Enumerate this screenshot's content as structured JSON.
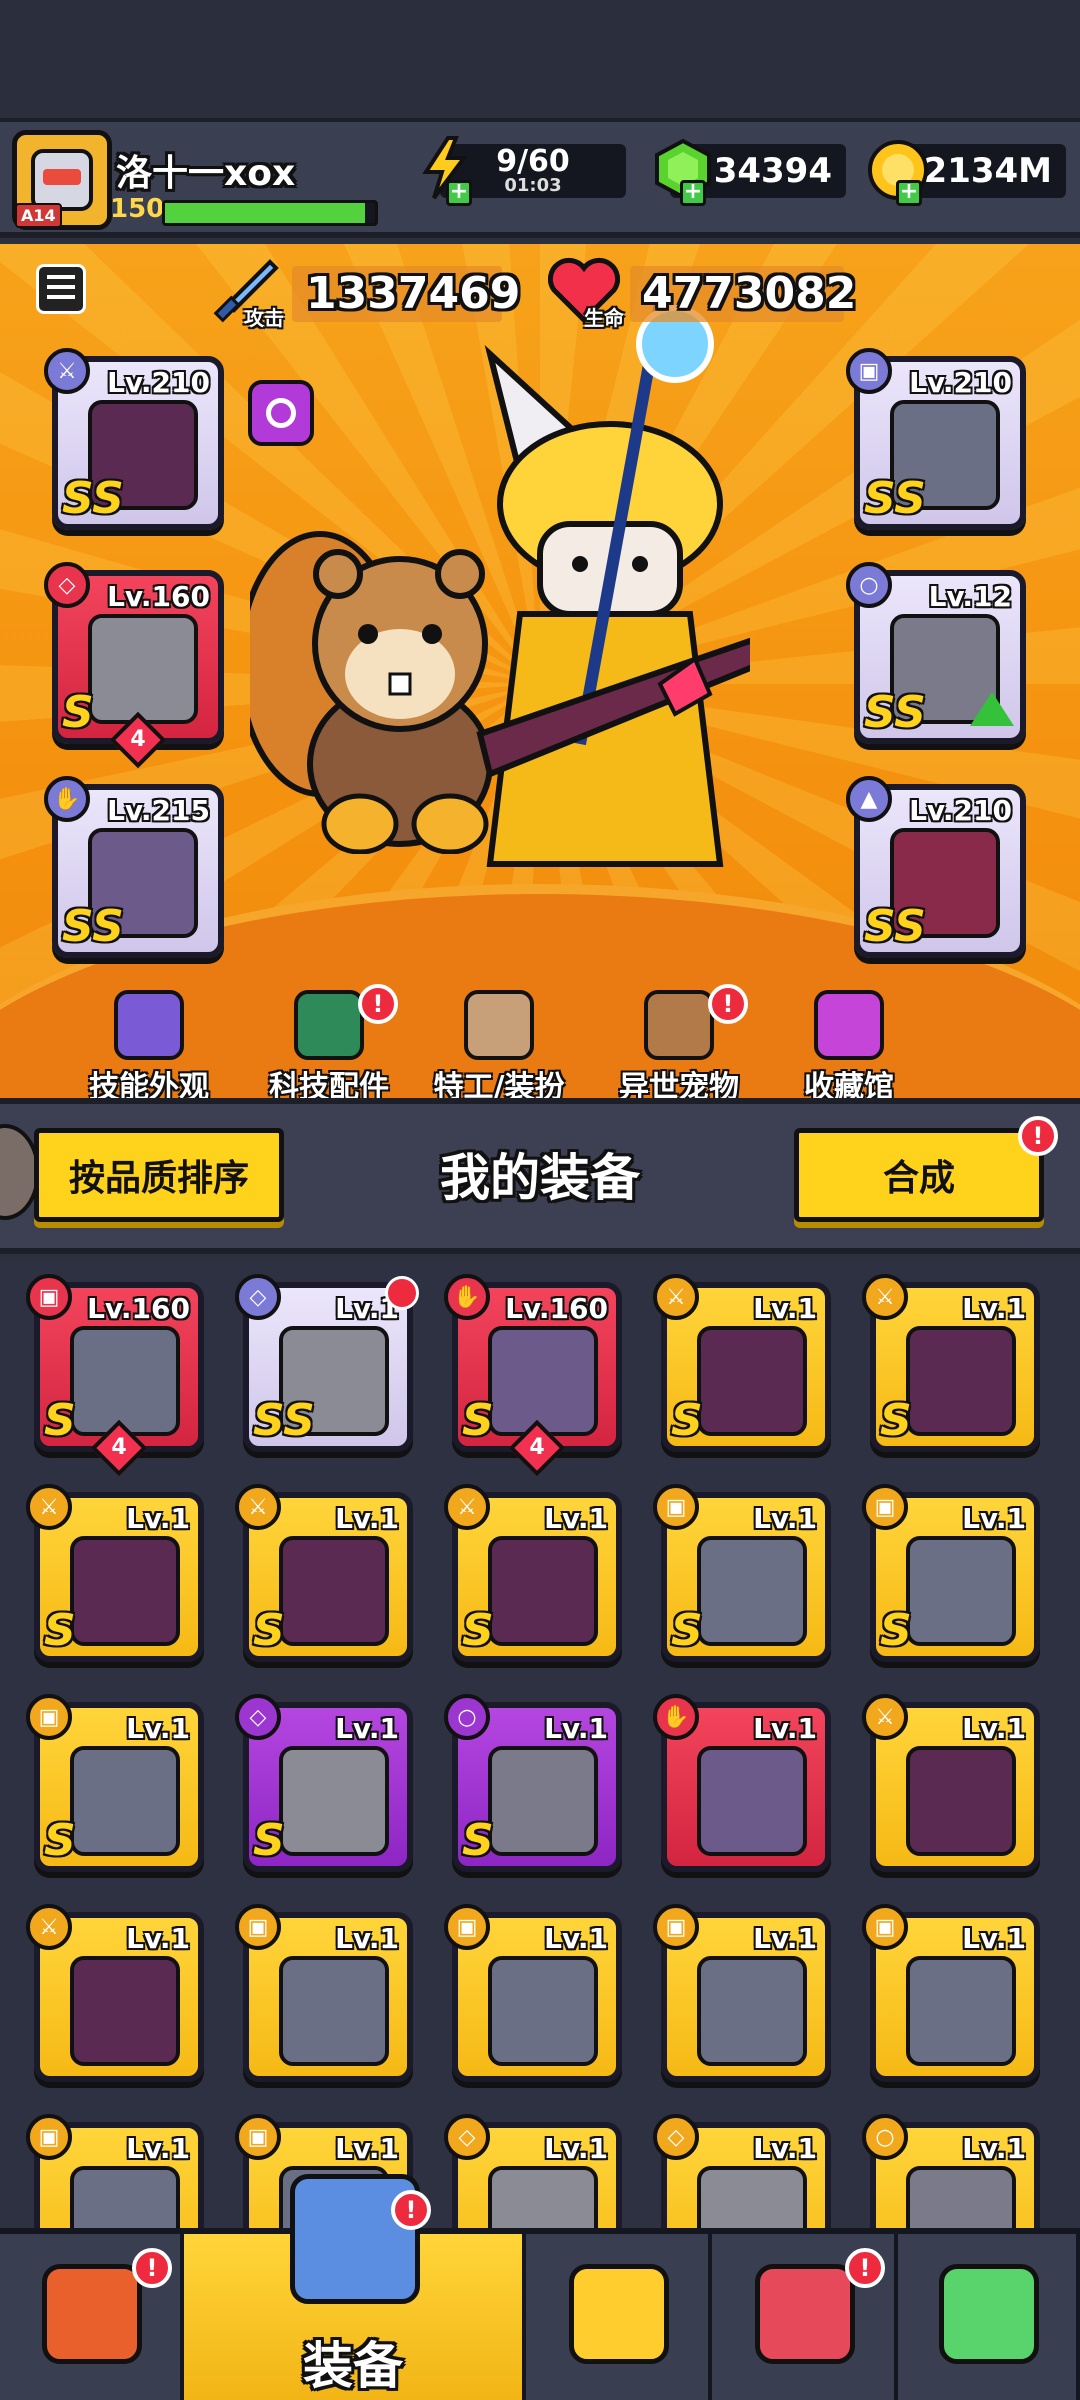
{
  "player": {
    "name": "洛十一xox",
    "level": "150",
    "rank_tag": "A14",
    "xp_fraction": 0.95
  },
  "resources": {
    "energy": {
      "value": "9/60",
      "timer": "01:03"
    },
    "gems": {
      "value": "34394"
    },
    "gold": {
      "value": "2134M"
    }
  },
  "stats": {
    "attack": {
      "label": "攻击",
      "value": "1337469"
    },
    "hp": {
      "label": "生命",
      "value": "4773082"
    }
  },
  "equipped": [
    {
      "slot": "weapon",
      "level": "Lv.210",
      "grade": "SS",
      "rarity": "white"
    },
    {
      "slot": "necklace",
      "level": "Lv.160",
      "grade": "S",
      "rarity": "red",
      "stars": "4"
    },
    {
      "slot": "glove",
      "level": "Lv.215",
      "grade": "SS",
      "rarity": "white"
    },
    {
      "slot": "armor",
      "level": "Lv.210",
      "grade": "SS",
      "rarity": "white"
    },
    {
      "slot": "belt",
      "level": "Lv.12",
      "grade": "SS",
      "rarity": "white",
      "upgrade": true
    },
    {
      "slot": "boots",
      "level": "Lv.210",
      "grade": "SS",
      "rarity": "white"
    }
  ],
  "hero_nav": [
    {
      "label": "技能外观",
      "badge": false
    },
    {
      "label": "科技配件",
      "badge": true
    },
    {
      "label": "特工/装扮",
      "badge": false
    },
    {
      "label": "异世宠物",
      "badge": true
    },
    {
      "label": "收藏馆",
      "badge": false
    }
  ],
  "equipment_panel": {
    "title": "我的装备",
    "sort_button": "按品质排序",
    "merge_button": "合成"
  },
  "inventory": [
    {
      "level": "Lv.160",
      "grade": "S",
      "rarity": "red",
      "stars": "4",
      "slot": "armor"
    },
    {
      "level": "Lv.1",
      "grade": "SS",
      "rarity": "white",
      "slot": "necklace",
      "badge": true
    },
    {
      "level": "Lv.160",
      "grade": "S",
      "rarity": "red",
      "stars": "4",
      "slot": "glove"
    },
    {
      "level": "Lv.1",
      "grade": "S",
      "rarity": "yel",
      "slot": "weapon"
    },
    {
      "level": "Lv.1",
      "grade": "S",
      "rarity": "yel",
      "slot": "weapon"
    },
    {
      "level": "Lv.1",
      "grade": "S",
      "rarity": "yel",
      "slot": "weapon"
    },
    {
      "level": "Lv.1",
      "grade": "S",
      "rarity": "yel",
      "slot": "weapon"
    },
    {
      "level": "Lv.1",
      "grade": "S",
      "rarity": "yel",
      "slot": "weapon"
    },
    {
      "level": "Lv.1",
      "grade": "S",
      "rarity": "yel",
      "slot": "armor"
    },
    {
      "level": "Lv.1",
      "grade": "S",
      "rarity": "yel",
      "slot": "armor"
    },
    {
      "level": "Lv.1",
      "grade": "S",
      "rarity": "yel",
      "slot": "armor"
    },
    {
      "level": "Lv.1",
      "grade": "S",
      "rarity": "pur",
      "slot": "necklace"
    },
    {
      "level": "Lv.1",
      "grade": "S",
      "rarity": "pur",
      "slot": "belt"
    },
    {
      "level": "Lv.1",
      "grade": "",
      "rarity": "red",
      "slot": "glove"
    },
    {
      "level": "Lv.1",
      "grade": "",
      "rarity": "yel",
      "slot": "weapon"
    },
    {
      "level": "Lv.1",
      "grade": "",
      "rarity": "yel",
      "slot": "weapon"
    },
    {
      "level": "Lv.1",
      "grade": "",
      "rarity": "yel",
      "slot": "armor"
    },
    {
      "level": "Lv.1",
      "grade": "",
      "rarity": "yel",
      "slot": "armor"
    },
    {
      "level": "Lv.1",
      "grade": "",
      "rarity": "yel",
      "slot": "armor"
    },
    {
      "level": "Lv.1",
      "grade": "",
      "rarity": "yel",
      "slot": "armor"
    },
    {
      "level": "Lv.1",
      "grade": "",
      "rarity": "yel",
      "slot": "armor"
    },
    {
      "level": "Lv.1",
      "grade": "",
      "rarity": "yel",
      "slot": "armor"
    },
    {
      "level": "Lv.1",
      "grade": "",
      "rarity": "yel",
      "slot": "necklace"
    },
    {
      "level": "Lv.1",
      "grade": "",
      "rarity": "yel",
      "slot": "necklace"
    },
    {
      "level": "Lv.1",
      "grade": "",
      "rarity": "yel",
      "slot": "belt"
    }
  ],
  "bottom_nav": [
    {
      "name": "shop",
      "label": "",
      "badge": true
    },
    {
      "name": "equipment",
      "label": "装备",
      "badge": true,
      "active": true
    },
    {
      "name": "battle",
      "label": "",
      "badge": false
    },
    {
      "name": "planets",
      "label": "",
      "badge": true
    },
    {
      "name": "lab",
      "label": "",
      "badge": false
    }
  ],
  "colors": {
    "orange_bg": "#f59410",
    "rarity_white": "#e2dbf5",
    "rarity_red": "#e4324c",
    "rarity_yellow": "#ffc926",
    "rarity_purple": "#a239d6",
    "accent_yellow": "#ffd21c"
  }
}
